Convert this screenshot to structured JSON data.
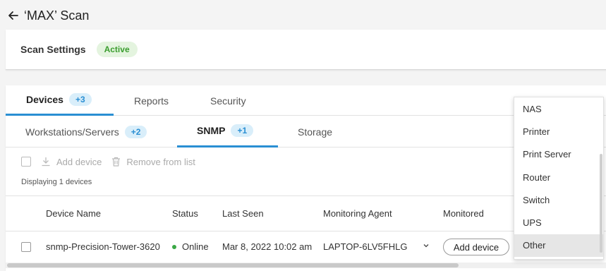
{
  "header": {
    "title": "‘MAX’ Scan"
  },
  "scan_settings": {
    "label": "Scan Settings",
    "status": "Active"
  },
  "tabs": [
    {
      "label": "Devices",
      "count": "+3"
    },
    {
      "label": "Reports"
    },
    {
      "label": "Security"
    }
  ],
  "subtabs": [
    {
      "label": "Workstations/Servers",
      "count": "+2"
    },
    {
      "label": "SNMP",
      "count": "+1"
    },
    {
      "label": "Storage"
    }
  ],
  "toolbar": {
    "add_device": "Add device",
    "remove_from_list": "Remove from list"
  },
  "displaying": "Displaying 1 devices",
  "table": {
    "headers": [
      "Device Name",
      "Status",
      "Last Seen",
      "Monitoring Agent",
      "Monitored"
    ],
    "rows": [
      {
        "device_name": "snmp-Precision-Tower-3620",
        "status": "Online",
        "last_seen": "Mar 8, 2022 10:02 am",
        "agent": "LAPTOP-6LV5FHLG",
        "action": "Add device"
      }
    ]
  },
  "dropdown": {
    "options": [
      "NAS",
      "Printer",
      "Print Server",
      "Router",
      "Switch",
      "UPS",
      "Other"
    ],
    "selected": "Other"
  },
  "colors": {
    "accent": "#2a8fd3",
    "active_green": "#3a9d2e",
    "online_dot": "#3aa845"
  }
}
